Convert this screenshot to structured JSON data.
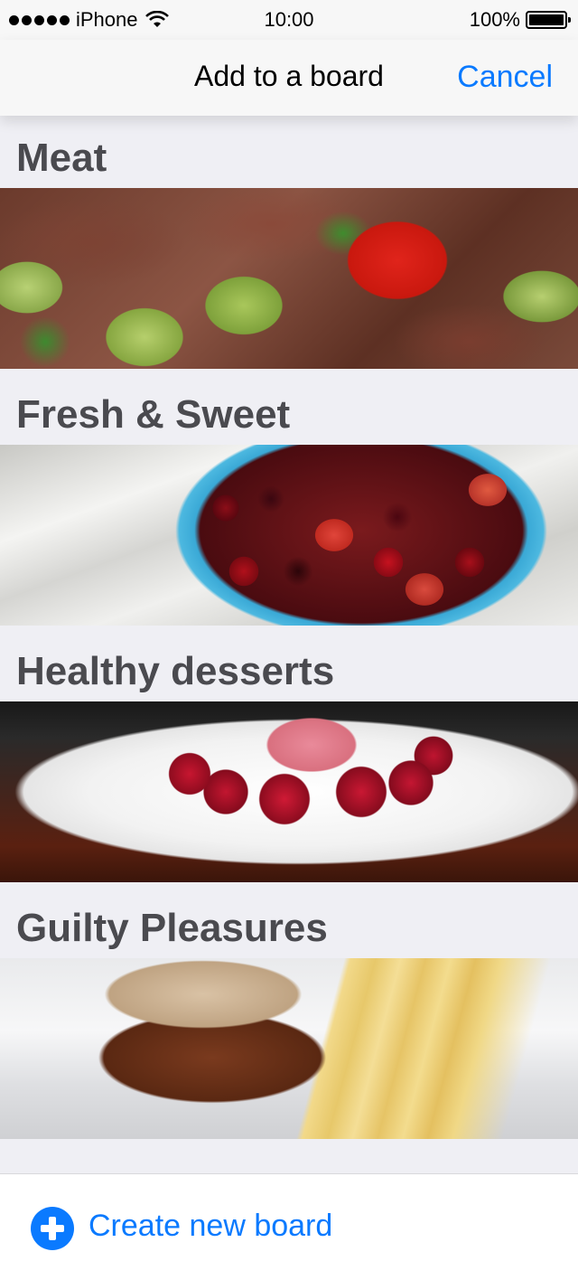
{
  "status_bar": {
    "carrier": "iPhone",
    "time": "10:00",
    "battery": "100%"
  },
  "nav": {
    "title": "Add to a board",
    "cancel_label": "Cancel"
  },
  "boards": [
    {
      "title": "Meat"
    },
    {
      "title": "Fresh & Sweet"
    },
    {
      "title": "Healthy desserts"
    },
    {
      "title": "Guilty Pleasures"
    }
  ],
  "footer": {
    "create_label": "Create new board"
  },
  "colors": {
    "accent": "#0a7aff",
    "background": "#efeff4",
    "title_gray": "#4a4a4f"
  }
}
